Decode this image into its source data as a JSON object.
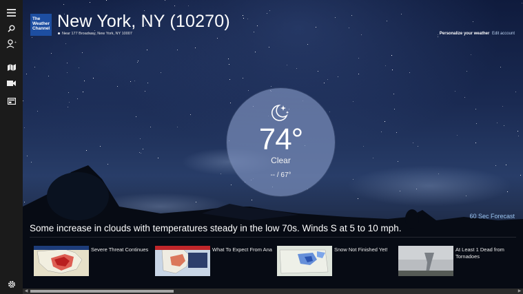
{
  "appbar": {
    "items": [
      {
        "name": "menu-icon"
      },
      {
        "name": "search-icon"
      },
      {
        "name": "location-icon"
      },
      {
        "name": "map-icon"
      },
      {
        "name": "video-icon"
      },
      {
        "name": "news-icon"
      },
      {
        "name": "settings-icon"
      }
    ]
  },
  "header": {
    "logo_lines": [
      "The",
      "Weather",
      "Channel"
    ],
    "city": "New York, NY (10270)",
    "near": "Near 177 Broadway, New York, NY 10007",
    "personalize_label": "Personalize your weather",
    "edit_account": "Edit account"
  },
  "current": {
    "temperature": "74°",
    "condition": "Clear",
    "hi_lo": "-- / 67°",
    "icon": "moon-stars-icon"
  },
  "forecast_link": "60 Sec Forecast",
  "summary": "Some increase in clouds with temperatures steady in the low 70s. Winds S at 5 to 10 mph.",
  "news": [
    {
      "title": "Severe Threat Continues",
      "thumb": "us-map-red"
    },
    {
      "title": "What To Expect From Ana",
      "thumb": "east-coast-map"
    },
    {
      "title": "Snow Not Finished Yet!",
      "thumb": "radar-map-blue"
    },
    {
      "title": "At Least 1 Dead from Tornadoes",
      "thumb": "tornado-photo"
    }
  ],
  "colors": {
    "appbar_bg": "#1b1b1b",
    "logo_bg": "#1d4ea1",
    "link": "#9cc6f2",
    "circle": "rgba(120,140,185,.72)"
  }
}
